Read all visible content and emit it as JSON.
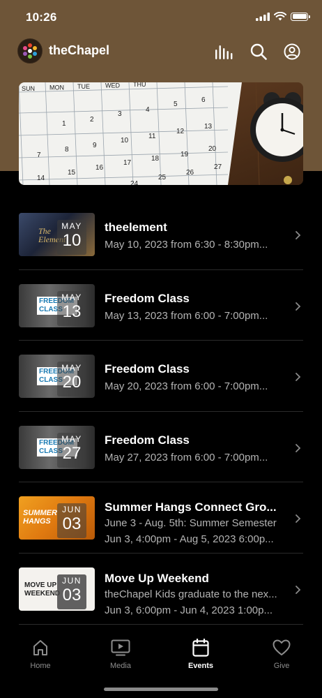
{
  "status_bar": {
    "time": "10:26"
  },
  "header": {
    "title": "theChapel"
  },
  "hero": {
    "weekdays": [
      "SUN",
      "MON",
      "TUE",
      "WED",
      "THU"
    ],
    "dates": [
      "1",
      "2",
      "3",
      "4",
      "5",
      "6",
      "7",
      "8",
      "9",
      "10",
      "11",
      "12",
      "13",
      "14",
      "15",
      "16",
      "17",
      "18",
      "19",
      "20",
      "24",
      "25",
      "26",
      "27"
    ]
  },
  "events": [
    {
      "title": "theelement",
      "subtitle": "May 10, 2023 from 6:30 - 8:30pm...",
      "month": "MAY",
      "day": "10",
      "thumb_text": "The Element"
    },
    {
      "title": "Freedom Class",
      "subtitle": "May 13, 2023 from 6:00 - 7:00pm...",
      "month": "MAY",
      "day": "13",
      "thumb_text": "FREEDOM CLASS"
    },
    {
      "title": "Freedom Class",
      "subtitle": "May 20, 2023 from 6:00 - 7:00pm...",
      "month": "MAY",
      "day": "20",
      "thumb_text": "FREEDOM CLASS"
    },
    {
      "title": "Freedom Class",
      "subtitle": "May 27, 2023 from 6:00 - 7:00pm...",
      "month": "MAY",
      "day": "27",
      "thumb_text": "FREEDOM CLASS"
    },
    {
      "title": "Summer Hangs Connect Gro...",
      "subtitle": "June 3 - Aug. 5th: Summer Semester",
      "subtitle2": "Jun 3, 4:00pm - Aug 5, 2023 6:00p...",
      "month": "JUN",
      "day": "03",
      "thumb_text": "SUMMER HANGS"
    },
    {
      "title": "Move Up Weekend",
      "subtitle": "theChapel Kids graduate to the nex...",
      "subtitle2": "Jun 3, 6:00pm - Jun 4, 2023 1:00p...",
      "month": "JUN",
      "day": "03",
      "thumb_text": "MOVE UP WEEKEND"
    }
  ],
  "tabs": [
    {
      "label": "Home",
      "icon": "home-icon"
    },
    {
      "label": "Media",
      "icon": "media-icon"
    },
    {
      "label": "Events",
      "icon": "calendar-icon"
    },
    {
      "label": "Give",
      "icon": "heart-icon"
    }
  ],
  "colors": {
    "brand_brown": "#6e5538",
    "background": "#000000",
    "subtext": "#b3b3b3",
    "tab_inactive": "#8d8d8d"
  }
}
